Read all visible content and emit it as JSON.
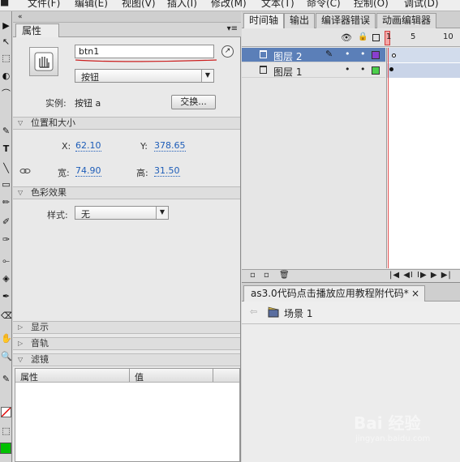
{
  "menubar": {
    "items": [
      "文件(F)",
      "编辑(E)",
      "视图(V)",
      "插入(I)",
      "修改(M)",
      "文本(T)",
      "命令(C)",
      "控制(O)",
      "调试(D)"
    ]
  },
  "tools": [
    "▶",
    "↖",
    "⬚",
    "◐",
    "⌒",
    "✎",
    "T",
    "╲",
    "▭",
    "✏",
    "✐",
    "🖌",
    "✑",
    "⟜",
    "◈",
    "✒",
    "⌫",
    "⌫",
    "✋",
    "🔍",
    "✎",
    "◻",
    "⬚",
    "■"
  ],
  "props": {
    "grip": "«",
    "tab_label": "属性",
    "instance_name": "btn1",
    "symbol_type": "按钮",
    "instance_label": "实例:",
    "instance_value": "按钮 a",
    "swap_label": "交换...",
    "position_section": "位置和大小",
    "x_label": "X:",
    "x_value": "62.10",
    "y_label": "Y:",
    "y_value": "378.65",
    "w_label": "宽:",
    "w_value": "74.90",
    "h_label": "高:",
    "h_value": "31.50",
    "color_section": "色彩效果",
    "style_label": "样式:",
    "style_value": "无",
    "display_section": "显示",
    "sound_section": "音轨",
    "filter_section": "滤镜",
    "filter_col_prop": "属性",
    "filter_col_value": "值"
  },
  "timeline": {
    "grip": "«",
    "tabs": [
      "时间轴",
      "输出",
      "编译器错误",
      "动画编辑器"
    ],
    "frame_numbers": [
      "1",
      "5",
      "10"
    ],
    "layers": [
      {
        "name": "图层 2",
        "selected": true,
        "outline_color": "#8a3ecf"
      },
      {
        "name": "图层 1",
        "selected": false,
        "outline_color": "#4ccf4c"
      }
    ],
    "playback": "|◀ ◀I I▶ ▶ ▶|"
  },
  "document": {
    "tab_title": "as3.0代码点击播放应用教程附代码*",
    "close": "×",
    "scene": "场景 1"
  },
  "watermark": {
    "brand": "Bai 经验",
    "url": "jingyan.baidu.com"
  },
  "colors": {
    "selection": "#5b7fb8",
    "link_value": "#1e5db8",
    "stroke_swatch": "#ffffff",
    "fill_swatch": "#00c000",
    "playhead": "#e34b4b"
  }
}
